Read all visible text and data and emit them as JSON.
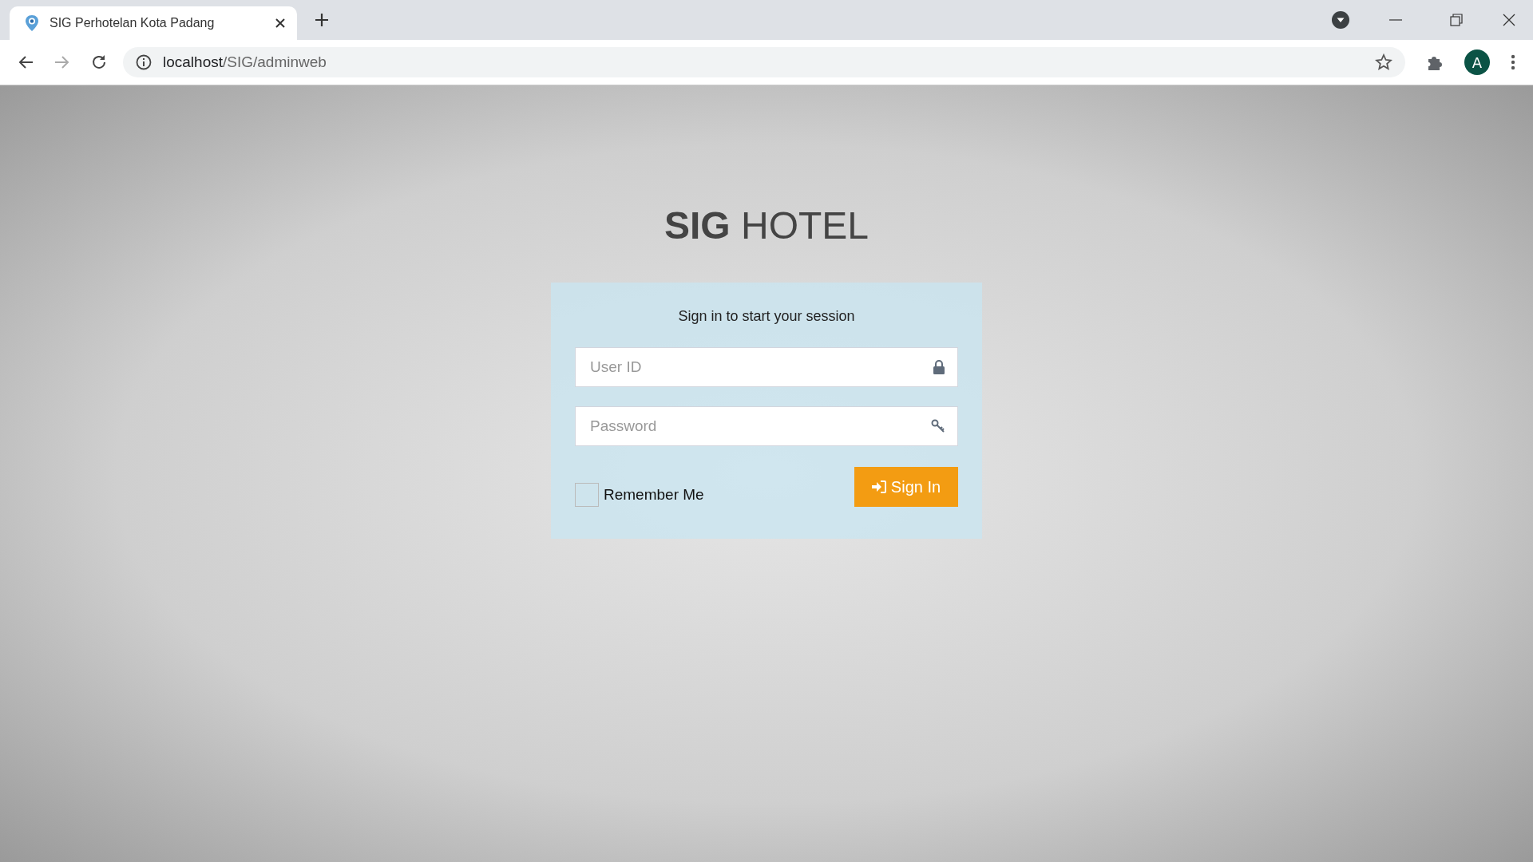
{
  "browser": {
    "tab_title": "SIG Perhotelan Kota Padang",
    "url_host": "localhost",
    "url_path": "/SIG/adminweb",
    "profile_initial": "A"
  },
  "login": {
    "logo": "**SIG** HOTEL",
    "message": "Sign in to start your session",
    "fields": [
      {
        "kind": "user",
        "placeholder": "User ID"
      },
      {
        "kind": "password",
        "placeholder": "Password"
      }
    ],
    "remember": {
      "label": "Remember Me",
      "checked": false
    },
    "submit": "Sign In"
  }
}
